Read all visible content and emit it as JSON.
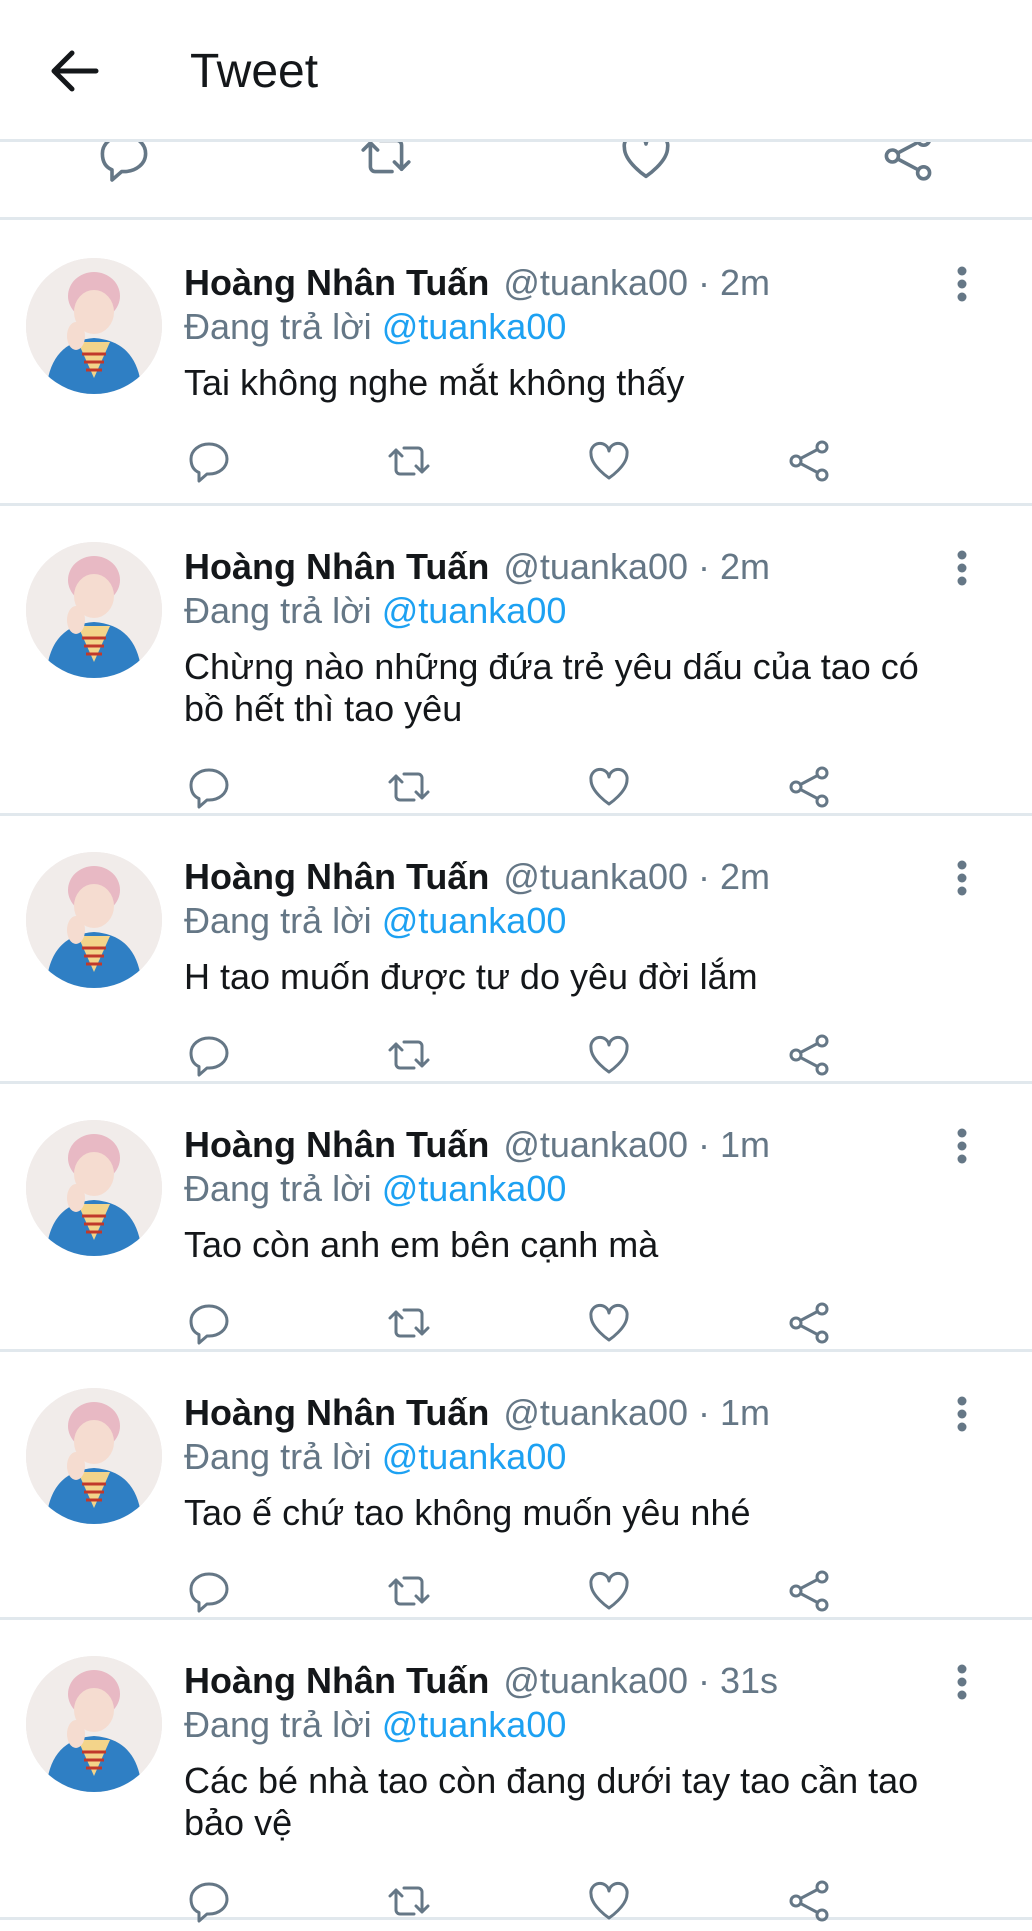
{
  "header": {
    "back_icon": "arrow-left-icon",
    "title": "Tweet"
  },
  "colors": {
    "accent": "#1da1f2",
    "text_primary": "#14171a",
    "text_secondary": "#657786",
    "divider": "#e1e8ed"
  },
  "action_icons": [
    "reply-icon",
    "retweet-icon",
    "like-icon",
    "share-icon"
  ],
  "tweets": [
    {
      "name": "Hoàng Nhân Tuấn",
      "handle": "@tuanka00 · 2m",
      "reply_prefix": "Đang trả lời",
      "reply_to": "@tuanka00",
      "text": "Tai không nghe mắt không thấy"
    },
    {
      "name": "Hoàng Nhân Tuấn",
      "handle": "@tuanka00 · 2m",
      "reply_prefix": "Đang trả lời",
      "reply_to": "@tuanka00",
      "text": "Chừng nào những đứa trẻ yêu dấu của tao có bồ hết thì tao yêu"
    },
    {
      "name": "Hoàng Nhân Tuấn",
      "handle": "@tuanka00 · 2m",
      "reply_prefix": "Đang trả lời",
      "reply_to": "@tuanka00",
      "text": "H tao muốn được tư do yêu đời lắm"
    },
    {
      "name": "Hoàng Nhân Tuấn",
      "handle": "@tuanka00 · 1m",
      "reply_prefix": "Đang trả lời",
      "reply_to": "@tuanka00",
      "text": "Tao còn anh em bên cạnh mà"
    },
    {
      "name": "Hoàng Nhân Tuấn",
      "handle": "@tuanka00 · 1m",
      "reply_prefix": "Đang trả lời",
      "reply_to": "@tuanka00",
      "text": "Tao ế chứ tao không muốn yêu nhé"
    },
    {
      "name": "Hoàng Nhân Tuấn",
      "handle": "@tuanka00 · 31s",
      "reply_prefix": "Đang trả lời",
      "reply_to": "@tuanka00",
      "text": "Các bé nhà tao còn đang dưới tay tao cần tao bảo vệ"
    }
  ]
}
